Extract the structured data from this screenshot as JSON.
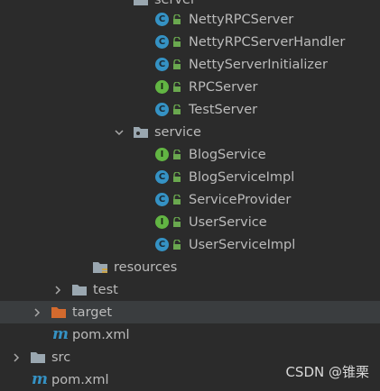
{
  "tree": {
    "partial_folder": "server",
    "server_items": [
      {
        "label": "NettyRPCServer",
        "kind": "class"
      },
      {
        "label": "NettyRPCServerHandler",
        "kind": "class"
      },
      {
        "label": "NettyServerInitializer",
        "kind": "class"
      },
      {
        "label": "RPCServer",
        "kind": "interface"
      },
      {
        "label": "TestServer",
        "kind": "class"
      }
    ],
    "service_folder": "service",
    "service_items": [
      {
        "label": "BlogService",
        "kind": "interface"
      },
      {
        "label": "BlogServiceImpl",
        "kind": "class"
      },
      {
        "label": "ServiceProvider",
        "kind": "class"
      },
      {
        "label": "UserService",
        "kind": "interface"
      },
      {
        "label": "UserServiceImpl",
        "kind": "class"
      }
    ],
    "resources_folder": "resources",
    "test_folder": "test",
    "target_folder": "target",
    "module_pom": "pom.xml",
    "src_folder": "src",
    "root_pom": "pom.xml"
  },
  "icons": {
    "class_letter": "C",
    "interface_letter": "I",
    "maven_letter": "m"
  },
  "colors": {
    "background": "#2b2b2b",
    "class_icon": "#3592c4",
    "interface_icon": "#62b543",
    "target_folder": "#d36a2e"
  },
  "watermark": {
    "text": "CSDN @锥栗",
    "faint": ""
  }
}
